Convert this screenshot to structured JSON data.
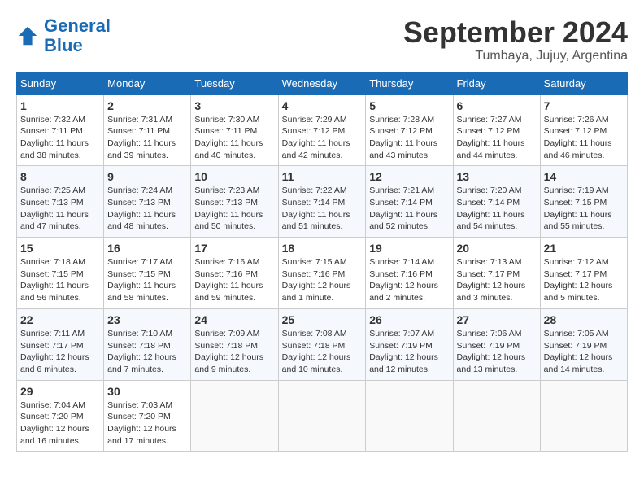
{
  "logo": {
    "text_general": "General",
    "text_blue": "Blue"
  },
  "title": "September 2024",
  "subtitle": "Tumbaya, Jujuy, Argentina",
  "days_of_week": [
    "Sunday",
    "Monday",
    "Tuesday",
    "Wednesday",
    "Thursday",
    "Friday",
    "Saturday"
  ],
  "weeks": [
    [
      {
        "day": 1,
        "sunrise": "7:32 AM",
        "sunset": "7:11 PM",
        "daylight": "11 hours and 38 minutes."
      },
      {
        "day": 2,
        "sunrise": "7:31 AM",
        "sunset": "7:11 PM",
        "daylight": "11 hours and 39 minutes."
      },
      {
        "day": 3,
        "sunrise": "7:30 AM",
        "sunset": "7:11 PM",
        "daylight": "11 hours and 40 minutes."
      },
      {
        "day": 4,
        "sunrise": "7:29 AM",
        "sunset": "7:12 PM",
        "daylight": "11 hours and 42 minutes."
      },
      {
        "day": 5,
        "sunrise": "7:28 AM",
        "sunset": "7:12 PM",
        "daylight": "11 hours and 43 minutes."
      },
      {
        "day": 6,
        "sunrise": "7:27 AM",
        "sunset": "7:12 PM",
        "daylight": "11 hours and 44 minutes."
      },
      {
        "day": 7,
        "sunrise": "7:26 AM",
        "sunset": "7:12 PM",
        "daylight": "11 hours and 46 minutes."
      }
    ],
    [
      {
        "day": 8,
        "sunrise": "7:25 AM",
        "sunset": "7:13 PM",
        "daylight": "11 hours and 47 minutes."
      },
      {
        "day": 9,
        "sunrise": "7:24 AM",
        "sunset": "7:13 PM",
        "daylight": "11 hours and 48 minutes."
      },
      {
        "day": 10,
        "sunrise": "7:23 AM",
        "sunset": "7:13 PM",
        "daylight": "11 hours and 50 minutes."
      },
      {
        "day": 11,
        "sunrise": "7:22 AM",
        "sunset": "7:14 PM",
        "daylight": "11 hours and 51 minutes."
      },
      {
        "day": 12,
        "sunrise": "7:21 AM",
        "sunset": "7:14 PM",
        "daylight": "11 hours and 52 minutes."
      },
      {
        "day": 13,
        "sunrise": "7:20 AM",
        "sunset": "7:14 PM",
        "daylight": "11 hours and 54 minutes."
      },
      {
        "day": 14,
        "sunrise": "7:19 AM",
        "sunset": "7:15 PM",
        "daylight": "11 hours and 55 minutes."
      }
    ],
    [
      {
        "day": 15,
        "sunrise": "7:18 AM",
        "sunset": "7:15 PM",
        "daylight": "11 hours and 56 minutes."
      },
      {
        "day": 16,
        "sunrise": "7:17 AM",
        "sunset": "7:15 PM",
        "daylight": "11 hours and 58 minutes."
      },
      {
        "day": 17,
        "sunrise": "7:16 AM",
        "sunset": "7:16 PM",
        "daylight": "11 hours and 59 minutes."
      },
      {
        "day": 18,
        "sunrise": "7:15 AM",
        "sunset": "7:16 PM",
        "daylight": "12 hours and 1 minute."
      },
      {
        "day": 19,
        "sunrise": "7:14 AM",
        "sunset": "7:16 PM",
        "daylight": "12 hours and 2 minutes."
      },
      {
        "day": 20,
        "sunrise": "7:13 AM",
        "sunset": "7:17 PM",
        "daylight": "12 hours and 3 minutes."
      },
      {
        "day": 21,
        "sunrise": "7:12 AM",
        "sunset": "7:17 PM",
        "daylight": "12 hours and 5 minutes."
      }
    ],
    [
      {
        "day": 22,
        "sunrise": "7:11 AM",
        "sunset": "7:17 PM",
        "daylight": "12 hours and 6 minutes."
      },
      {
        "day": 23,
        "sunrise": "7:10 AM",
        "sunset": "7:18 PM",
        "daylight": "12 hours and 7 minutes."
      },
      {
        "day": 24,
        "sunrise": "7:09 AM",
        "sunset": "7:18 PM",
        "daylight": "12 hours and 9 minutes."
      },
      {
        "day": 25,
        "sunrise": "7:08 AM",
        "sunset": "7:18 PM",
        "daylight": "12 hours and 10 minutes."
      },
      {
        "day": 26,
        "sunrise": "7:07 AM",
        "sunset": "7:19 PM",
        "daylight": "12 hours and 12 minutes."
      },
      {
        "day": 27,
        "sunrise": "7:06 AM",
        "sunset": "7:19 PM",
        "daylight": "12 hours and 13 minutes."
      },
      {
        "day": 28,
        "sunrise": "7:05 AM",
        "sunset": "7:19 PM",
        "daylight": "12 hours and 14 minutes."
      }
    ],
    [
      {
        "day": 29,
        "sunrise": "7:04 AM",
        "sunset": "7:20 PM",
        "daylight": "12 hours and 16 minutes."
      },
      {
        "day": 30,
        "sunrise": "7:03 AM",
        "sunset": "7:20 PM",
        "daylight": "12 hours and 17 minutes."
      },
      null,
      null,
      null,
      null,
      null
    ]
  ]
}
